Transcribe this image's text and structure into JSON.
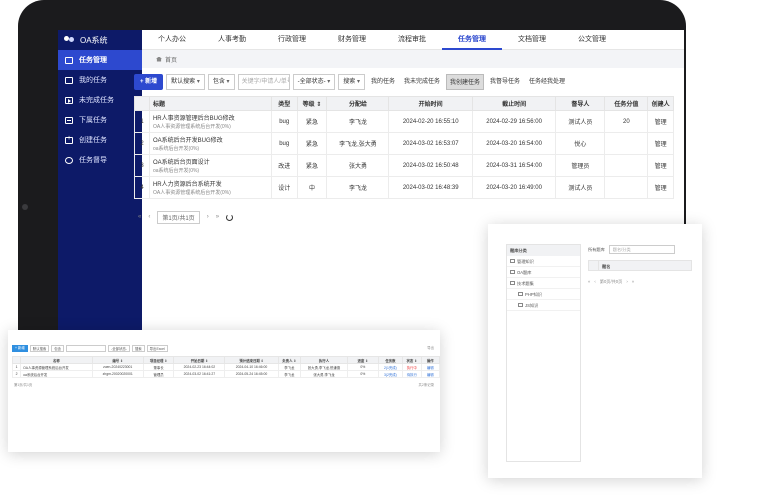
{
  "brand": {
    "title": "OA系统"
  },
  "sidebar": {
    "items": [
      {
        "label": "任务管理",
        "icon": "user-icon",
        "active": true
      },
      {
        "label": "我的任务",
        "icon": "list-icon"
      },
      {
        "label": "未完成任务",
        "icon": "play-icon"
      },
      {
        "label": "下属任务",
        "icon": "download-icon"
      },
      {
        "label": "创建任务",
        "icon": "add-icon"
      },
      {
        "label": "任务督导",
        "icon": "eye-icon"
      }
    ]
  },
  "topnav": {
    "items": [
      {
        "label": "个人办公"
      },
      {
        "label": "人事考勤"
      },
      {
        "label": "行政管理"
      },
      {
        "label": "财务管理"
      },
      {
        "label": "流程审批"
      },
      {
        "label": "任务管理",
        "active": true
      },
      {
        "label": "文档管理"
      },
      {
        "label": "公文管理"
      }
    ]
  },
  "breadcrumb": {
    "home": "首页"
  },
  "toolbar": {
    "add_label": "+ 新增",
    "search_mode": "默认搜索",
    "contains": "包含",
    "keyword_placeholder": "关键字/申请人/单号",
    "status": "-全部状态-",
    "search": "搜索",
    "filter_tabs": [
      {
        "label": "我的任务"
      },
      {
        "label": "我未完成任务"
      },
      {
        "label": "我创建任务",
        "active": true
      },
      {
        "label": "我督导任务"
      },
      {
        "label": "任务经我处理"
      }
    ]
  },
  "table": {
    "headers": [
      "",
      "标题",
      "类型",
      "等级 ⇕",
      "分配给",
      "开始时间",
      "截止时间",
      "督导人",
      "任务分值",
      "创建人"
    ],
    "rows": [
      {
        "no": "1",
        "title": "HR人事资源管理后台BUG修改",
        "sub": "OA人事资源管理系统后台开发(0%)",
        "type": "bug",
        "level": "紧急",
        "assignee": "李飞龙",
        "start": "2024-02-20 16:55:10",
        "end": "2024-02-29 16:56:00",
        "supervisor": "测试人员",
        "score": "20",
        "creator": "管理"
      },
      {
        "no": "2",
        "title": "OA系统后台开发BUG修改",
        "sub": "oa系统后台开发(0%)",
        "type": "bug",
        "level": "紧急",
        "assignee": "李飞龙,张大勇",
        "start": "2024-03-02 16:53:07",
        "end": "2024-03-20 16:54:00",
        "supervisor": "悦心",
        "score": "",
        "creator": "管理"
      },
      {
        "no": "3",
        "title": "OA系统后台页面设计",
        "sub": "oa系统后台开发(0%)",
        "type": "改进",
        "level": "紧急",
        "assignee": "张大勇",
        "start": "2024-03-02 16:50:48",
        "end": "2024-03-31 16:54:00",
        "supervisor": "管理员",
        "score": "",
        "creator": "管理"
      },
      {
        "no": "4",
        "title": "HR人力资源后台系统开发",
        "sub": "OA人事资源管理系统后台开发(0%)",
        "type": "设计",
        "level": "中",
        "assignee": "李飞龙",
        "start": "2024-03-02 16:48:39",
        "end": "2024-03-20 16:49:00",
        "supervisor": "测试人员",
        "score": "",
        "creator": "管理"
      }
    ]
  },
  "pager": {
    "first": "«",
    "prev": "‹",
    "page": "第1页/共1页",
    "next": "›",
    "last": "»"
  },
  "card_b": {
    "add_label": "+ 新增",
    "search_mode": "默认搜索",
    "contains": "包含",
    "status": "-全部状态-",
    "search": "搜索",
    "export": "导出Excel",
    "top_right": "导出",
    "headers": [
      "",
      "名称",
      "编号 ⇕",
      "项目经理 ⇕",
      "开始日期 ⇕",
      "预计结束日期 ⇕",
      "负责人 ⇕",
      "执行人",
      "进度 ⇕",
      "任务数",
      "状态 ⇕",
      "操作"
    ],
    "rows": [
      {
        "no": "1",
        "name": "OA人事资源管理系统后台开发",
        "code": "zuen-20240223001",
        "pm": "董事长",
        "start": "2024-02-23 16:44:02",
        "end": "2024-04-10 16:46:00",
        "owner": "李飞龙",
        "exec": "张大勇,李飞龙,悦谦德",
        "progress": "0%",
        "tasks": "2(1完成)",
        "status": "执行中",
        "op": "编辑"
      },
      {
        "no": "2",
        "name": "oa系统后台开发",
        "code": "zhgm-20020020001",
        "pm": "管理员",
        "start": "2024-03-02 16:41:27",
        "end": "2024-05-24 16:45:00",
        "owner": "李飞龙",
        "exec": "张大勇,李飞龙",
        "progress": "0%",
        "tasks": "3(2完成)",
        "status": "待执行",
        "op": "编辑"
      }
    ],
    "pager": "第1页/共1页",
    "summary": "共2条记录"
  },
  "card_c": {
    "tree_header": "题库分类",
    "tree_items": [
      {
        "label": "管理知识",
        "child": false
      },
      {
        "label": "OA题库",
        "child": false
      },
      {
        "label": "技术题集",
        "child": false
      },
      {
        "label": "PHP知识",
        "child": true
      },
      {
        "label": "JS知识",
        "child": true
      }
    ],
    "search_label": "所有题库",
    "search_placeholder": "题名/分类",
    "col": "题名",
    "pager": "第0页/共0页"
  }
}
